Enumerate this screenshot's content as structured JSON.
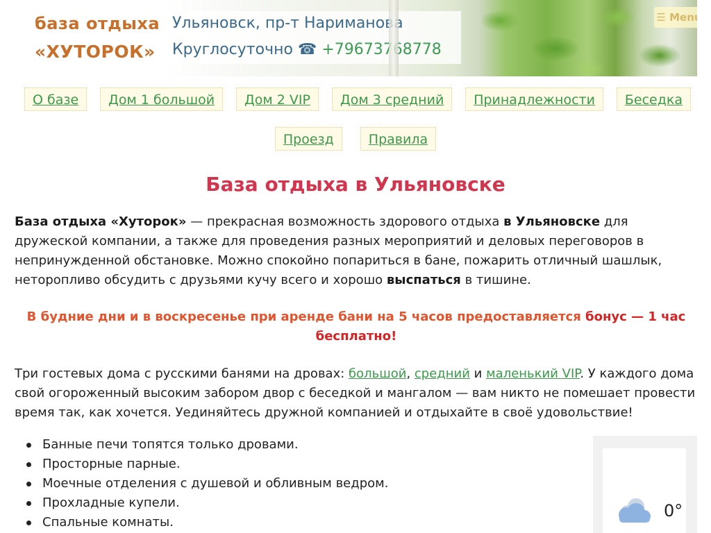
{
  "header": {
    "brand_line1": "база отдыха",
    "brand_line2": "«ХУТОРОК»",
    "address": "Ульяновск, пр-т Нариманова",
    "hours_label": "Круглосуточно",
    "phone_icon": "☎",
    "phone": "+79673768778",
    "menu_label": "☰ Menu"
  },
  "nav": {
    "row1": [
      "О базе",
      "Дом 1 большой",
      "Дом 2 VIP",
      "Дом 3 средний",
      "Принадлежности",
      "Беседка"
    ],
    "row2": [
      "Проезд",
      "Правила"
    ]
  },
  "main": {
    "title": "База отдыха в Ульяновске",
    "intro": {
      "bold_name": "База отдыха «Хуторок»",
      "text1": " — прекрасная возможность здорового отдыха ",
      "bold_city": "в Ульяновске",
      "text2": " для дружеской компании, а также для проведения разных мероприятий и деловых переговоров в непринужденной обстановке. Можно спокойно попариться в бане, пожарить отличный шашлык, неторопливо обсудить с друзьями кучу всего и хорошо ",
      "bold_sleep": "выспаться",
      "text3": " в тишине."
    },
    "bonus": {
      "text": "В будние дни и в воскресенье при аренде бани на 5 часов предоставляется ",
      "highlight": "бонус — 1 час бесплатно!"
    },
    "houses": {
      "text1": "Три гостевых дома с русскими банями на дровах: ",
      "link1": "большой",
      "sep1": ", ",
      "link2": "средний",
      "sep2": " и ",
      "link3": "маленький VIP",
      "text2": ". У каждого дома свой огороженный высоким забором двор с беседкой и мангалом — вам никто не помешает провести время так, как хочется. Уединяйтесь дружной компанией и отдыхайте в своё удовольствие!"
    },
    "features": [
      "Банные печи топятся только дровами.",
      "Просторные парные.",
      "Моечные отделения с душевой и обливным ведром.",
      "Прохладные купели.",
      "Спальные комнаты."
    ]
  },
  "weather": {
    "icon": "cloud-icon",
    "temperature": "0°"
  }
}
